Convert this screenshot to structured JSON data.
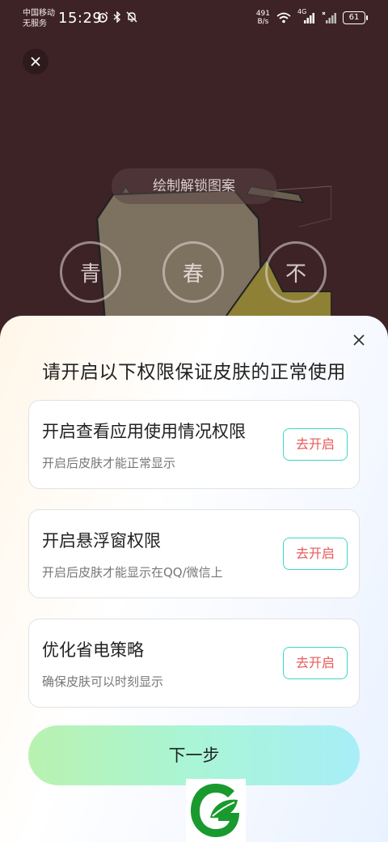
{
  "status_bar": {
    "carrier_line1": "中国移动",
    "carrier_line2": "无服务",
    "time": "15:29",
    "net_speed_value": "491",
    "net_speed_unit": "B/s",
    "network_type": "4G",
    "battery": "61"
  },
  "lock_screen": {
    "hint": "绘制解锁图案",
    "nodes": [
      "青",
      "春",
      "不"
    ]
  },
  "sheet": {
    "title": "请开启以下权限保证皮肤的正常使用",
    "permissions": [
      {
        "title": "开启查看应用使用情况权限",
        "subtitle": "开启后皮肤才能正常显示",
        "button": "去开启"
      },
      {
        "title": "开启悬浮窗权限",
        "subtitle": "开启后皮肤才能显示在QQ/微信上",
        "button": "去开启"
      },
      {
        "title": "优化省电策略",
        "subtitle": "确保皮肤可以时刻显示",
        "button": "去开启"
      }
    ],
    "next_button": "下一步"
  },
  "colors": {
    "background": "#3e2326",
    "button_border": "#3dd6c4",
    "button_text": "#e85a5a",
    "logo_green": "#1a9a2e"
  },
  "icons": [
    "alarm-icon",
    "bluetooth-icon",
    "mute-icon",
    "wifi-icon",
    "signal-icon",
    "close-icon",
    "app-logo-icon"
  ]
}
